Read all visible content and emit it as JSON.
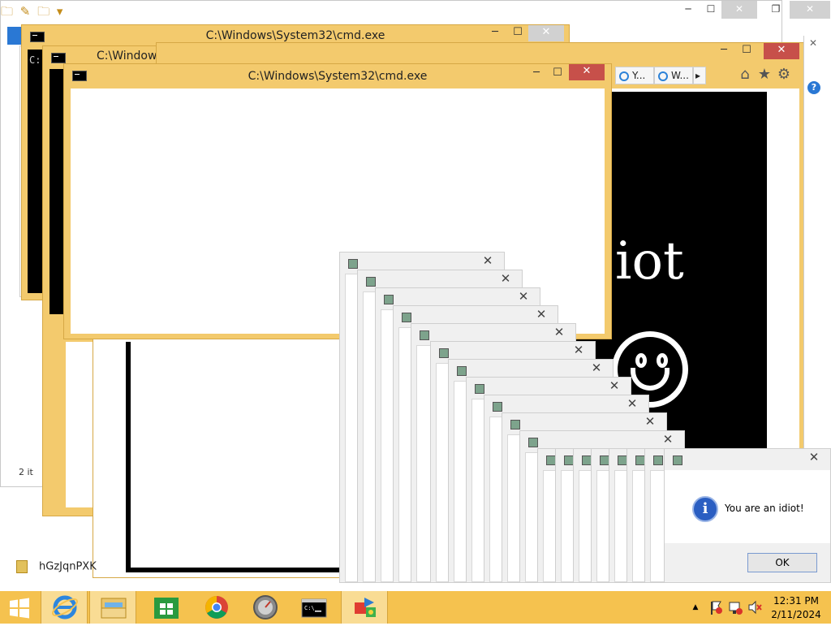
{
  "explorer": {
    "status_items": "2 it",
    "file_name": "hGzJqnPXK",
    "controls": {
      "minimize": "─",
      "maximize": "☐",
      "close": "✕",
      "restore": "❐"
    }
  },
  "cmd_back": {
    "title": "C:\\Windows\\System32\\cmd.exe",
    "prompt": "C:"
  },
  "cmd_middle": {
    "title": "C:\\Window"
  },
  "cmd_front": {
    "title": "C:\\Windows\\System32\\cmd.exe"
  },
  "ie": {
    "tab1": "Y...",
    "tab2": "W...",
    "tab_scroll": "▸",
    "home_icon": "⌂",
    "star_icon": "★",
    "gear_icon": "⚙",
    "help_icon": "?"
  },
  "prank": {
    "text": "iot"
  },
  "popup_close": "✕",
  "message_box": {
    "text": "You are an idiot!",
    "ok": "OK",
    "icon_glyph": "i"
  },
  "tray": {
    "time": "12:31 PM",
    "date": "2/11/2024",
    "up_arrow": "▲"
  },
  "colors": {
    "accent": "#f5c24f",
    "close_red": "#c7504a",
    "info_blue": "#2a5ec2"
  }
}
